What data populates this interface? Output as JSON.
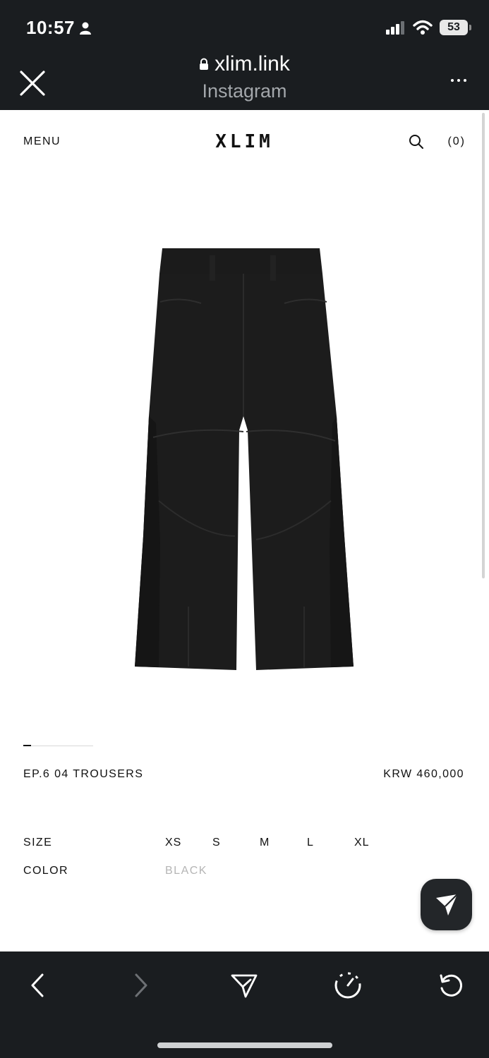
{
  "status_bar": {
    "time": "10:57",
    "battery": "53"
  },
  "browser": {
    "url": "xlim.link",
    "source": "Instagram"
  },
  "site": {
    "menu_label": "MENU",
    "brand": "XLIM",
    "cart_label": "(0)"
  },
  "product": {
    "name": "EP.6 04 TROUSERS",
    "price": "KRW 460,000",
    "image_color": "#1c1c1c",
    "size_label": "SIZE",
    "sizes": [
      "XS",
      "S",
      "M",
      "L",
      "XL"
    ],
    "color_label": "COLOR",
    "colors": [
      "BLACK"
    ]
  },
  "icons": {
    "close": "close-icon",
    "lock": "lock-icon",
    "more": "more-icon",
    "search": "search-icon",
    "share": "send-icon",
    "back": "back-icon",
    "forward": "forward-icon",
    "speed": "speedometer-icon",
    "reload": "reload-icon"
  },
  "theme": {
    "bar_bg": "#1a1d20",
    "accent": "#111111"
  }
}
